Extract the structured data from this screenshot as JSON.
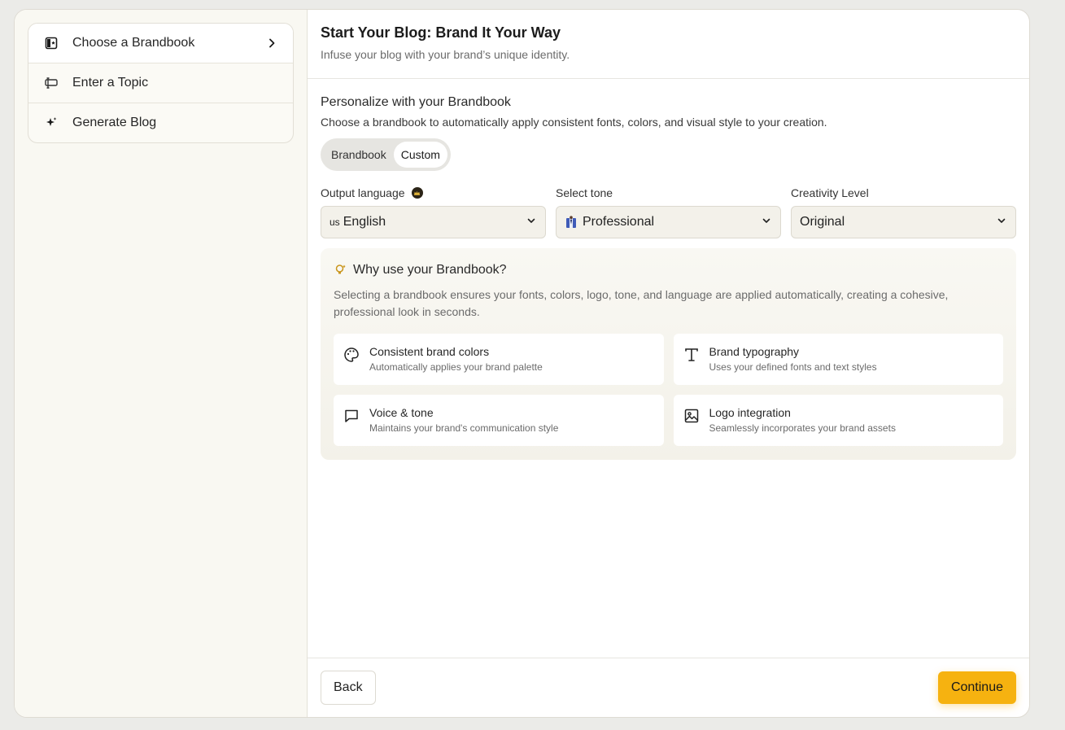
{
  "sidebar": {
    "steps": [
      {
        "label": "Choose a Brandbook",
        "icon": "brandbook-icon",
        "active": true
      },
      {
        "label": "Enter a Topic",
        "icon": "topic-icon"
      },
      {
        "label": "Generate Blog",
        "icon": "sparkles-icon"
      }
    ]
  },
  "header": {
    "title": "Start Your Blog: Brand It Your Way",
    "subtitle": "Infuse your blog with your brand’s unique identity."
  },
  "brandbook": {
    "title": "Personalize with your Brandbook",
    "description": "Choose a brandbook to automatically apply consistent fonts, colors, and visual style to your creation.",
    "toggle": {
      "options": [
        "Brandbook",
        "Custom"
      ],
      "selected": "Custom"
    }
  },
  "fields": {
    "language": {
      "label": "Output language",
      "flag": "us",
      "value": "English"
    },
    "tone": {
      "label": "Select tone",
      "value": "Professional"
    },
    "creativity": {
      "label": "Creativity Level",
      "value": "Original"
    }
  },
  "why": {
    "title": "Why use your Brandbook?",
    "description": "Selecting a brandbook ensures your fonts, colors, logo, tone, and language are applied automatically, creating a cohesive, professional look in seconds.",
    "cards": [
      {
        "title": "Consistent brand colors",
        "desc": "Automatically applies your brand palette",
        "icon": "palette-icon"
      },
      {
        "title": "Brand typography",
        "desc": "Uses your defined fonts and text styles",
        "icon": "typography-icon"
      },
      {
        "title": "Voice & tone",
        "desc": "Maintains your brand's communication style",
        "icon": "message-icon"
      },
      {
        "title": "Logo integration",
        "desc": "Seamlessly incorporates your brand assets",
        "icon": "image-icon"
      }
    ]
  },
  "footer": {
    "back": "Back",
    "continue": "Continue"
  },
  "colors": {
    "accent": "#f6b210",
    "sidebar_bg": "#f9f8f2"
  }
}
